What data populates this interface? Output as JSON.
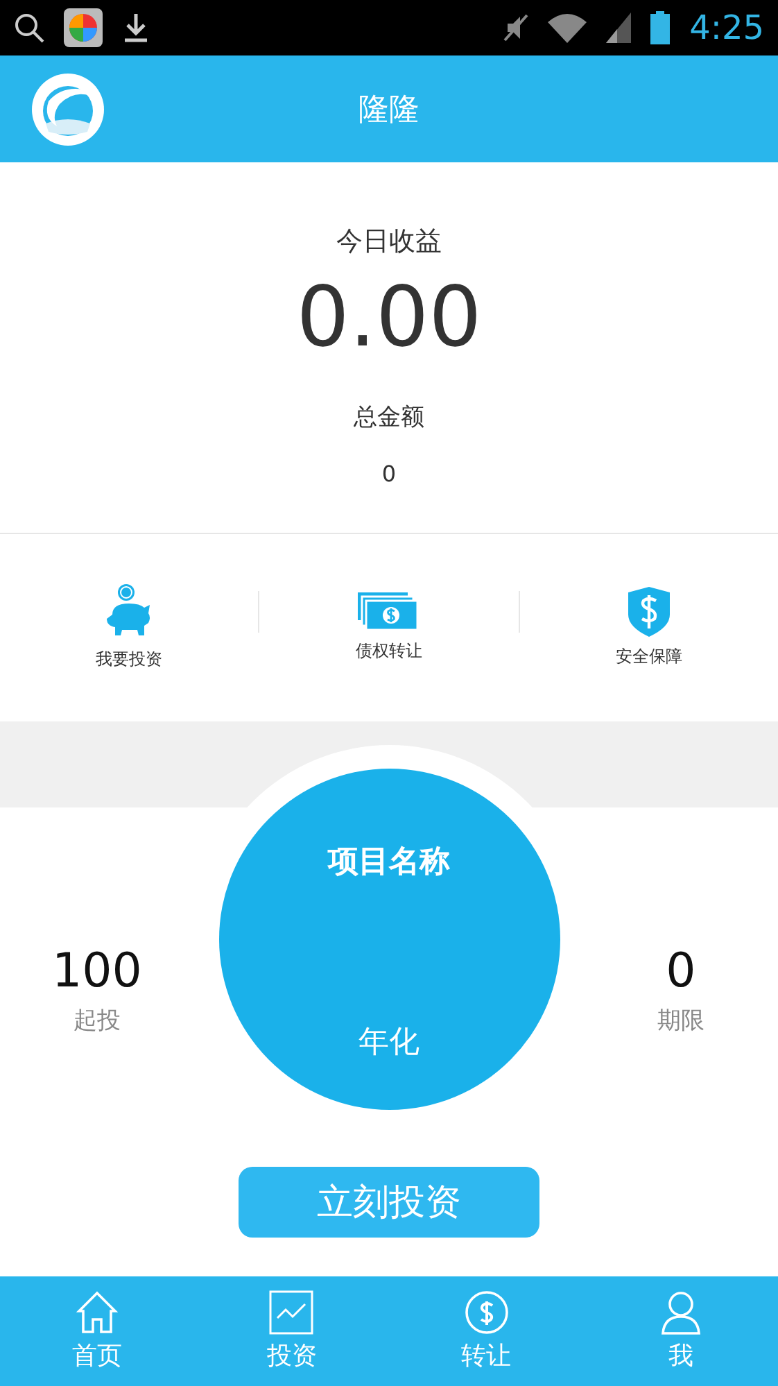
{
  "status_bar": {
    "time": "4:25"
  },
  "header": {
    "title": "隆隆"
  },
  "summary": {
    "today_label": "今日收益",
    "today_value": "0.00",
    "total_label": "总金额",
    "total_value": "0"
  },
  "shortcuts": [
    {
      "kind": "piggy",
      "label": "我要投资"
    },
    {
      "kind": "bills",
      "label": "债权转让"
    },
    {
      "kind": "shield",
      "label": "安全保障"
    }
  ],
  "project": {
    "name": "项目名称",
    "rate_label": "年化",
    "min_value": "100",
    "min_label": "起投",
    "term_value": "0",
    "term_label": "期限",
    "button": "立刻投资"
  },
  "tabs": [
    {
      "kind": "home",
      "label": "首页",
      "selected": false
    },
    {
      "kind": "chart",
      "label": "投资",
      "selected": false
    },
    {
      "kind": "dollar",
      "label": "转让",
      "selected": false
    },
    {
      "kind": "person",
      "label": "我",
      "selected": false
    }
  ]
}
